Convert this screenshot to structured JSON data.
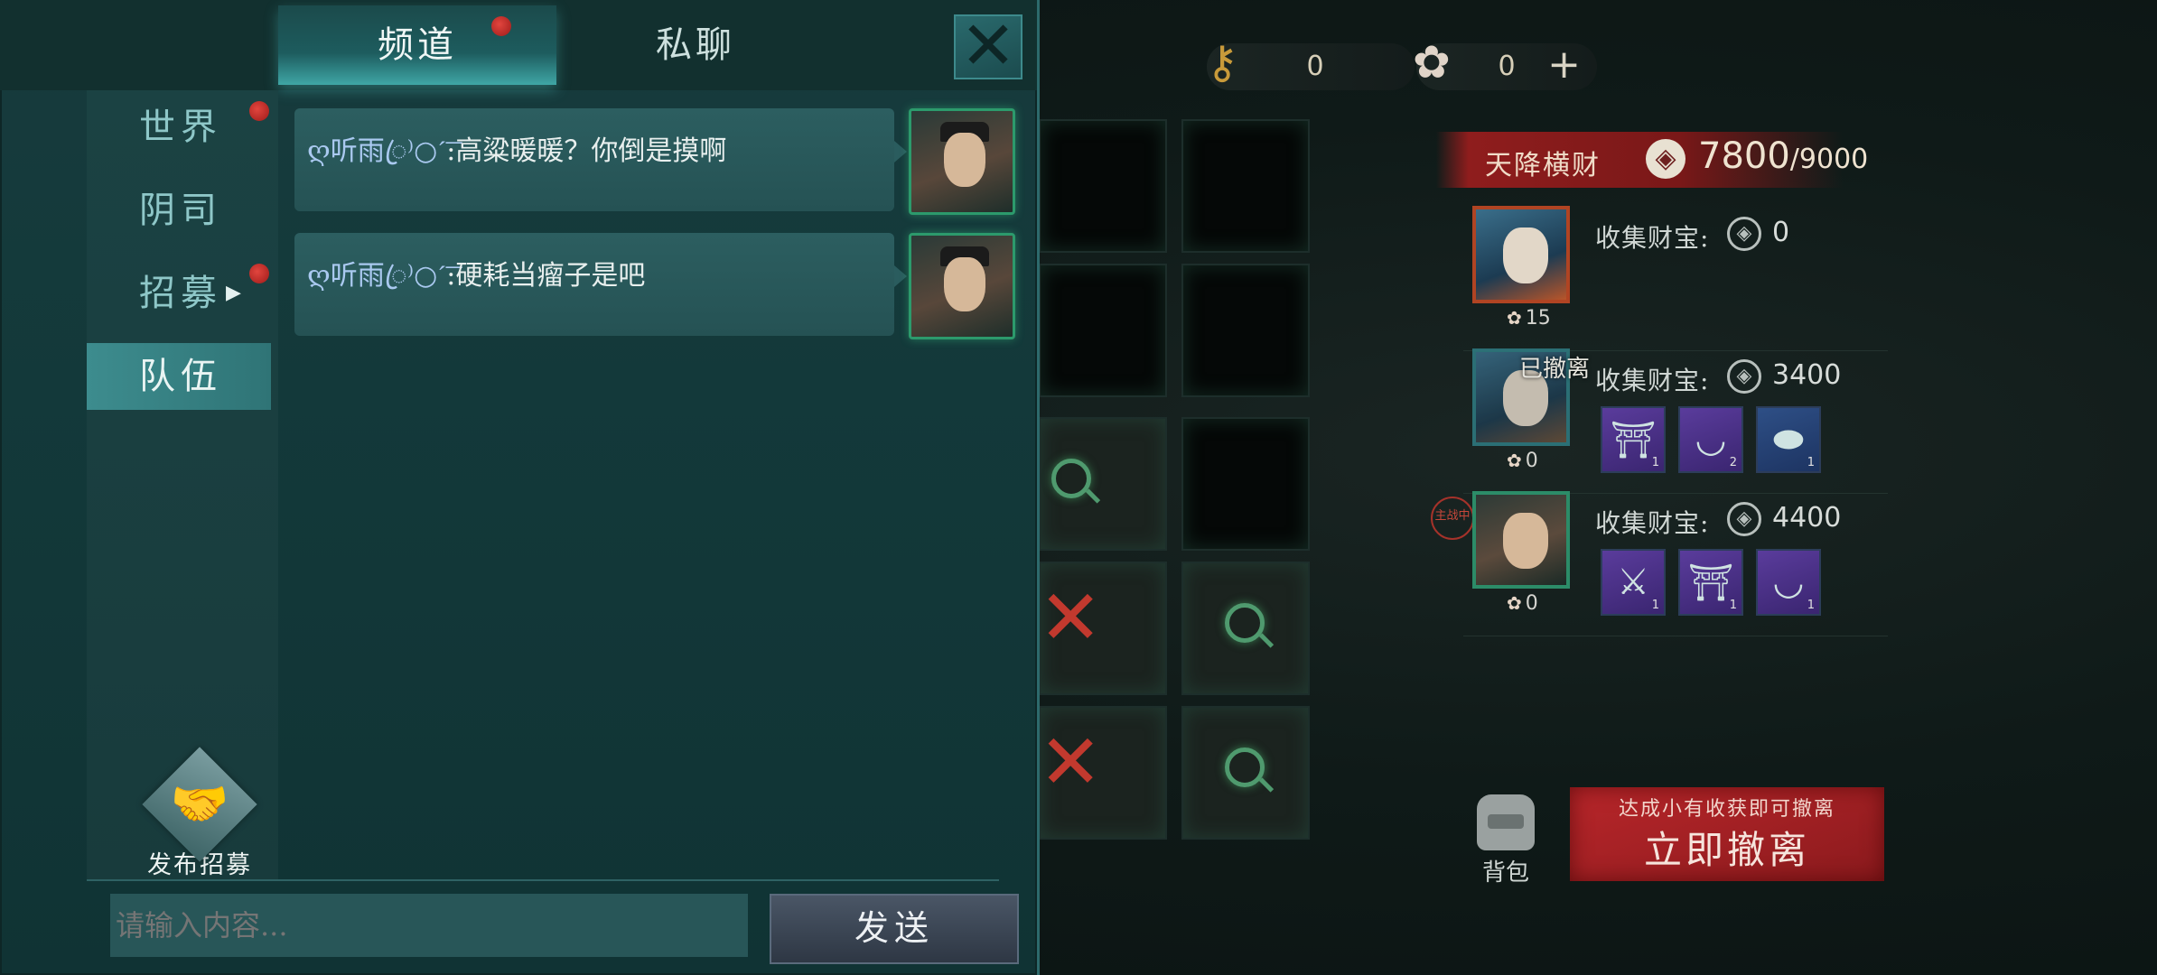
{
  "resources": {
    "keys": {
      "icon": "golden-key-icon",
      "value": "0"
    },
    "tokens": {
      "icon": "flower-token-icon",
      "value": "0",
      "add": "+"
    }
  },
  "event": {
    "title": "天降横财",
    "current": "7800",
    "separator": "/",
    "target": "9000"
  },
  "team": {
    "collect_label": "收集财宝:",
    "members": [
      {
        "amount": "0",
        "count": "15",
        "status": "",
        "tag": "",
        "items": []
      },
      {
        "amount": "3400",
        "count": "0",
        "status": "已撤离",
        "tag": "",
        "items": [
          {
            "icon": "incense-burner-icon",
            "rarity": "purple",
            "qty": "1"
          },
          {
            "icon": "jade-bowl-icon",
            "rarity": "purple",
            "qty": "2"
          },
          {
            "icon": "gold-ingot-icon",
            "rarity": "blue",
            "qty": "1"
          }
        ]
      },
      {
        "amount": "4400",
        "count": "0",
        "status": "",
        "tag": "主战中",
        "items": [
          {
            "icon": "jade-dagger-icon",
            "rarity": "purple",
            "qty": "1"
          },
          {
            "icon": "incense-burner-icon",
            "rarity": "purple",
            "qty": "1"
          },
          {
            "icon": "jade-bowl-icon",
            "rarity": "purple",
            "qty": "1"
          }
        ]
      }
    ]
  },
  "actions": {
    "backpack": "背包",
    "evacuate_hint": "达成小有收获即可撤离",
    "evacuate": "立即撤离"
  },
  "chat": {
    "tabs": [
      {
        "label": "频道",
        "badge": true
      },
      {
        "label": "私聊",
        "badge": false
      }
    ],
    "close_icon": "close-x-icon",
    "sidebar": [
      {
        "label": "世界",
        "badge": true,
        "active": false
      },
      {
        "label": "阴司",
        "badge": false,
        "active": false
      },
      {
        "label": "招募",
        "badge": true,
        "active": false
      },
      {
        "label": "队伍",
        "badge": false,
        "active": true
      }
    ],
    "recruit_label": "发布招募",
    "messages": [
      {
        "sender": "ღ听雨ꦿ⁾○ˊ͞",
        "text": ":高粱暖暖？你倒是摸啊"
      },
      {
        "sender": "ღ听雨ꦿ⁾○ˊ͞",
        "text": ":硬耗当瘤子是吧"
      }
    ],
    "input_placeholder": "请输入内容...",
    "send_label": "发送"
  },
  "colors": {
    "accent": "#3fa6a5",
    "danger": "#b8262a",
    "badge": "#e2453e"
  }
}
